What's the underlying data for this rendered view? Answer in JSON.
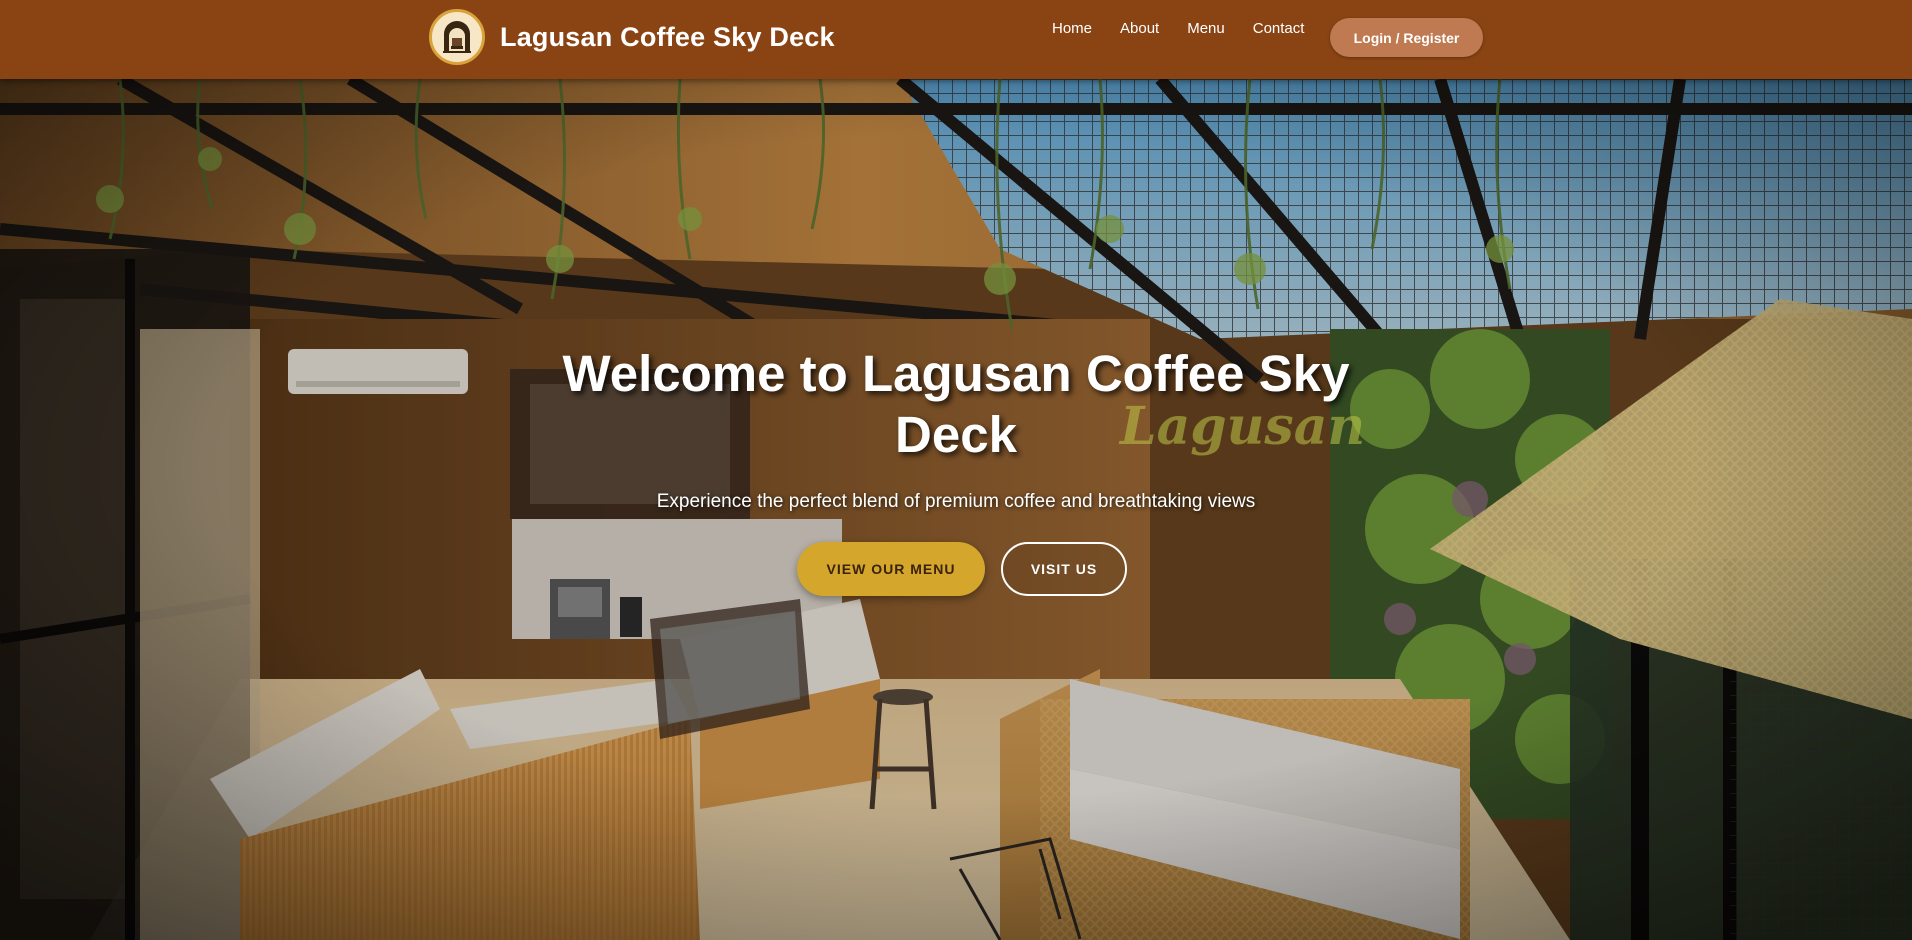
{
  "nav": {
    "brand_name": "Lagusan Coffee Sky Deck",
    "links": [
      "Home",
      "About",
      "Menu",
      "Contact"
    ],
    "login_label": "Login / Register"
  },
  "hero": {
    "title": "Welcome to Lagusan Coffee Sky Deck",
    "subtitle": "Experience the perfect blend of premium coffee and breathtaking views",
    "primary_button": "VIEW OUR MENU",
    "secondary_button": "VISIT US",
    "neon_sign_text": "Lagusan"
  },
  "icons": {
    "logo": "storefront-arch-icon"
  },
  "colors": {
    "navbar": "#8a4413",
    "login_button": "#c07a52",
    "primary_button": "#d4a62c",
    "neon_sign": "#e8f25a"
  }
}
